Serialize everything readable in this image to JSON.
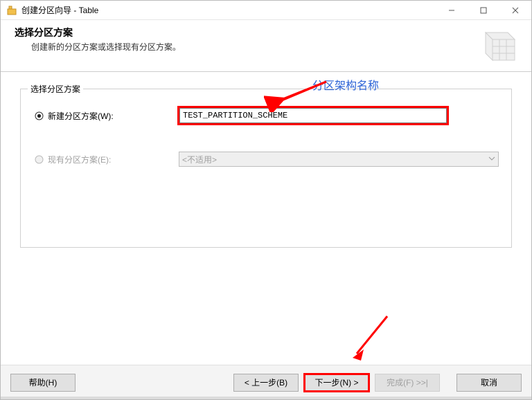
{
  "window": {
    "title": "创建分区向导 - Table"
  },
  "header": {
    "title": "选择分区方案",
    "desc": "创建新的分区方案或选择现有分区方案。"
  },
  "legend": "选择分区方案",
  "option_new": {
    "label": "新建分区方案(W):",
    "value": "TEST_PARTITION_SCHEME"
  },
  "option_existing": {
    "label": "现有分区方案(E):",
    "select_text": "<不适用>"
  },
  "buttons": {
    "help": "帮助(H)",
    "back": "< 上一步(B)",
    "next": "下一步(N) >",
    "finish": "完成(F) >>|",
    "cancel": "取消"
  },
  "annotations": {
    "scheme_name": "分区架构名称"
  }
}
